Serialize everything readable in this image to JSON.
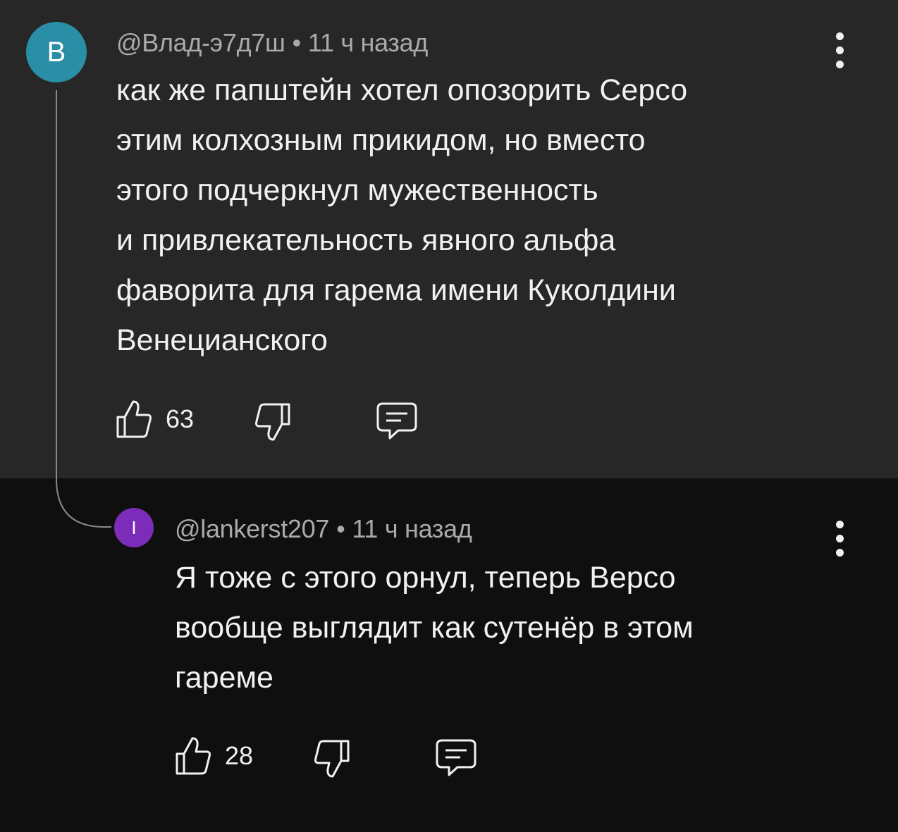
{
  "colors": {
    "top_bg": "#272727",
    "bottom_bg": "#0f0f0f",
    "avatar_main": "#2a8fa6",
    "avatar_reply": "#7b2cb8",
    "text_primary": "#f1f1f1",
    "text_secondary": "#aaaaaa"
  },
  "comment": {
    "avatar_letter": "В",
    "author": "@Влад-э7д7ш",
    "separator": "•",
    "time": "11 ч назад",
    "text": "как же папштейн хотел опозорить Серсо\nэтим колхозным прикидом, но вместо\nэтого подчеркнул мужественность\nи привлекательность явного альфа\nфаворита для гарема имени Куколдини\nВенецианского",
    "likes": "63",
    "icons": {
      "like": "thumb-up-icon",
      "dislike": "thumb-down-icon",
      "reply": "comment-icon",
      "more": "more-vertical-icon"
    }
  },
  "reply": {
    "avatar_letter": "I",
    "author": "@lankerst207",
    "separator": "•",
    "time": "11 ч назад",
    "text": "Я тоже с этого орнул, теперь Версо\nвообще выглядит как сутенёр в этом\nгареме",
    "likes": "28",
    "icons": {
      "like": "thumb-up-icon",
      "dislike": "thumb-down-icon",
      "reply": "comment-icon",
      "more": "more-vertical-icon"
    }
  }
}
